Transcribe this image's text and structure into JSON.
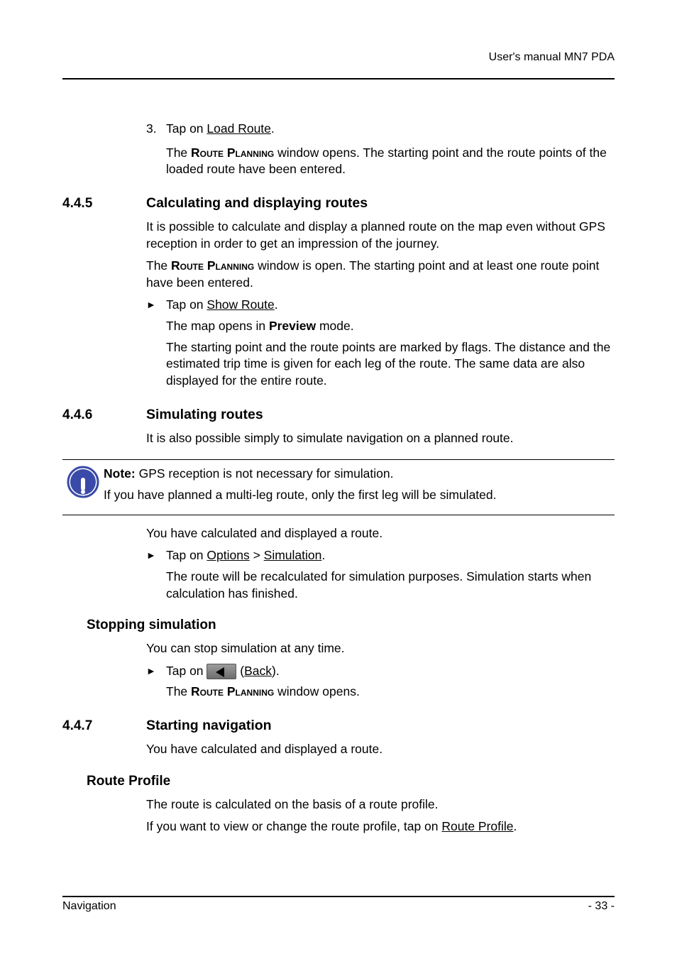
{
  "header": {
    "running": "User's manual MN7 PDA"
  },
  "pre_ol": {
    "num": "3.",
    "text_a": "Tap on ",
    "text_b": "Load Route",
    "text_c": "."
  },
  "pre_para": {
    "t1": "The ",
    "t2": "Route Planning",
    "t3": " window opens. The starting point and the route points of the loaded route have been entered."
  },
  "sec445": {
    "num": "4.4.5",
    "title": "Calculating and displaying routes",
    "p1": "It is possible to calculate and display a planned route on the map even without GPS reception in order to get an impression of the journey.",
    "p2a": "The ",
    "p2b": "Route Planning",
    "p2c": " window is open. The starting point and at least one route point have been entered.",
    "bullet_a": "Tap on ",
    "bullet_b": "Show Route",
    "bullet_c": ".",
    "sub1a": "The map opens in ",
    "sub1b": "Preview",
    "sub1c": " mode.",
    "sub2": "The starting point and the route points are marked by flags. The distance and the estimated trip time is given for each leg of the route. The same data are also displayed for the entire route."
  },
  "sec446": {
    "num": "4.4.6",
    "title": "Simulating routes",
    "p1": "It is also possible simply to simulate navigation on a planned route.",
    "note_l1a": "Note:",
    "note_l1b": " GPS reception is not necessary for simulation.",
    "note_l2": "If you have planned a multi-leg route, only the first leg will be simulated.",
    "p2": "You have calculated and displayed a route.",
    "bullet_a": "Tap on ",
    "bullet_b": "Options",
    "bullet_c": " > ",
    "bullet_d": "Simulation",
    "bullet_e": ".",
    "sub1": "The route will be recalculated for simulation purposes. Simulation starts when calculation has finished."
  },
  "stopping": {
    "title": "Stopping simulation",
    "p1": "You can stop simulation at any time.",
    "bullet_a": "Tap on ",
    "bullet_b_left": " (",
    "bullet_b_link": "Back",
    "bullet_b_right": ").",
    "sub1a": "The ",
    "sub1b": "Route Planning",
    "sub1c": " window opens."
  },
  "sec447": {
    "num": "4.4.7",
    "title": "Starting navigation",
    "p1": "You have calculated and displayed a route."
  },
  "routeprofile": {
    "title": "Route Profile",
    "p1": "The route is calculated on the basis of a route profile.",
    "p2a": "If you want to view or change the route profile, tap on ",
    "p2b": "Route Profile",
    "p2c": "."
  },
  "footer": {
    "left": "Navigation",
    "right": "- 33 -"
  }
}
